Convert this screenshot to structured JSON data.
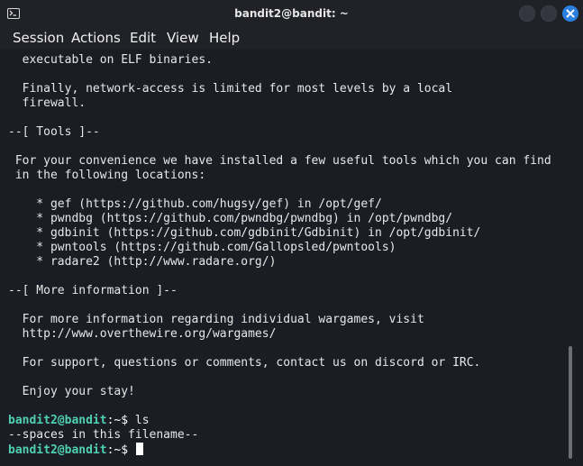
{
  "window": {
    "title": "bandit2@bandit: ~",
    "icon": "terminal-icon",
    "buttons": [
      "minimize-icon",
      "maximize-icon",
      "close-icon"
    ],
    "accent_color": "#2b7fe0"
  },
  "menubar": {
    "items": [
      "Session",
      "Actions",
      "Edit",
      "View",
      "Help"
    ]
  },
  "terminal": {
    "background_color": "#1b1d24",
    "prompt_color": "#4fd0b3",
    "lines": [
      "  executable on ELF binaries.",
      "",
      "  Finally, network-access is limited for most levels by a local",
      "  firewall.",
      "",
      "--[ Tools ]--",
      "",
      " For your convenience we have installed a few useful tools which you can find",
      " in the following locations:",
      "",
      "    * gef (https://github.com/hugsy/gef) in /opt/gef/",
      "    * pwndbg (https://github.com/pwndbg/pwndbg) in /opt/pwndbg/",
      "    * gdbinit (https://github.com/gdbinit/Gdbinit) in /opt/gdbinit/",
      "    * pwntools (https://github.com/Gallopsled/pwntools)",
      "    * radare2 (http://www.radare.org/)",
      "",
      "--[ More information ]--",
      "",
      "  For more information regarding individual wargames, visit",
      "  http://www.overthewire.org/wargames/",
      "",
      "  For support, questions or comments, contact us on discord or IRC.",
      "",
      "  Enjoy your stay!",
      ""
    ],
    "prompt_user": "bandit2@bandit",
    "prompt_path": ":~$ ",
    "command": "ls",
    "output": "--spaces in this filename--"
  }
}
